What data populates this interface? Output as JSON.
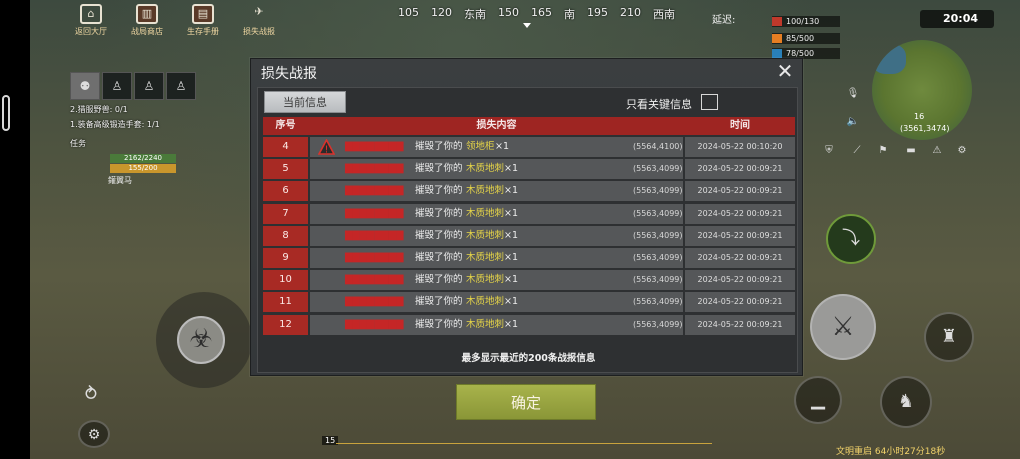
{
  "top_tools": [
    {
      "label": "返回大厅",
      "icon": "home-icon",
      "symbol": "⌂"
    },
    {
      "label": "战局商店",
      "icon": "shop-icon",
      "symbol": "▥"
    },
    {
      "label": "生存手册",
      "icon": "manual-icon",
      "symbol": "▤"
    },
    {
      "label": "损失战报",
      "icon": "report-icon",
      "symbol": "✈"
    }
  ],
  "compass": [
    "105",
    "120",
    "东南",
    "150",
    "165",
    "南",
    "195",
    "210",
    "西南"
  ],
  "status": {
    "delay_label": "延迟:",
    "clock": "20:04",
    "stats": [
      {
        "value": "100/130",
        "color": "#c0392b"
      },
      {
        "value": "85/500",
        "color": "#e67e22"
      },
      {
        "value": "78/500",
        "color": "#2980b9"
      }
    ],
    "minimap_coord": "(3561,3474)",
    "minimap_level": "16"
  },
  "mission": {
    "lines": [
      "2.猎服野兽: 0/1",
      "1.装备高级锻造手套: 1/1"
    ],
    "task_label": "任务",
    "hp": "2162/2240",
    "xp": "155/200",
    "name": "鑵翼马"
  },
  "modal": {
    "title": "损失战报",
    "tab_current": "当前信息",
    "key_only": "只看关键信息",
    "columns": {
      "num": "序号",
      "content": "损失内容",
      "time": "时间"
    },
    "rows": [
      {
        "num": "4",
        "actor": "▇▇▇▇▇▇▇▇",
        "verb": "摧毁了你的",
        "item": "领地柜",
        "qty": "×1",
        "coord": "(5564,4100)",
        "time": "2024-05-22 00:10:20",
        "warn": true
      },
      {
        "num": "5",
        "actor": "▇▇▇▇▇▇▇▇",
        "verb": "摧毁了你的",
        "item": "木质地刺",
        "qty": "×1",
        "coord": "(5563,4099)",
        "time": "2024-05-22 00:09:21",
        "warn": false
      },
      {
        "num": "6",
        "actor": "▇▇▇▇▇▇▇▇",
        "verb": "摧毁了你的",
        "item": "木质地刺",
        "qty": "×1",
        "coord": "(5563,4099)",
        "time": "2024-05-22 00:09:21",
        "warn": false
      },
      {
        "num": "7",
        "actor": "▇▇▇▇▇▇▇▇",
        "verb": "摧毁了你的",
        "item": "木质地刺",
        "qty": "×1",
        "coord": "(5563,4099)",
        "time": "2024-05-22 00:09:21",
        "warn": false
      },
      {
        "num": "8",
        "actor": "▇▇▇▇▇▇▇▇",
        "verb": "摧毁了你的",
        "item": "木质地刺",
        "qty": "×1",
        "coord": "(5563,4099)",
        "time": "2024-05-22 00:09:21",
        "warn": false
      },
      {
        "num": "9",
        "actor": "▇▇▇▇▇▇▇▇",
        "verb": "摧毁了你的",
        "item": "木质地刺",
        "qty": "×1",
        "coord": "(5563,4099)",
        "time": "2024-05-22 00:09:21",
        "warn": false
      },
      {
        "num": "10",
        "actor": "▇▇▇▇▇▇▇▇",
        "verb": "摧毁了你的",
        "item": "木质地刺",
        "qty": "×1",
        "coord": "(5563,4099)",
        "time": "2024-05-22 00:09:21",
        "warn": false
      },
      {
        "num": "11",
        "actor": "▇▇▇▇▇▇▇▇",
        "verb": "摧毁了你的",
        "item": "木质地刺",
        "qty": "×1",
        "coord": "(5563,4099)",
        "time": "2024-05-22 00:09:21",
        "warn": false
      },
      {
        "num": "12",
        "actor": "▇▇▇▇▇▇▇▇",
        "verb": "摧毁了你的",
        "item": "木质地刺",
        "qty": "×1",
        "coord": "(5563,4099)",
        "time": "2024-05-22 00:09:21",
        "warn": false
      }
    ],
    "footnote": "最多显示最近的200条战报信息",
    "confirm": "确定"
  },
  "bottom": {
    "level": "15",
    "restart": "文明重启 64小时27分18秒"
  },
  "colors": {
    "header_red": "#9e2522",
    "num_red": "#a82a24",
    "item_yellow": "#e5d448",
    "confirm_green": "#a8b34b"
  }
}
